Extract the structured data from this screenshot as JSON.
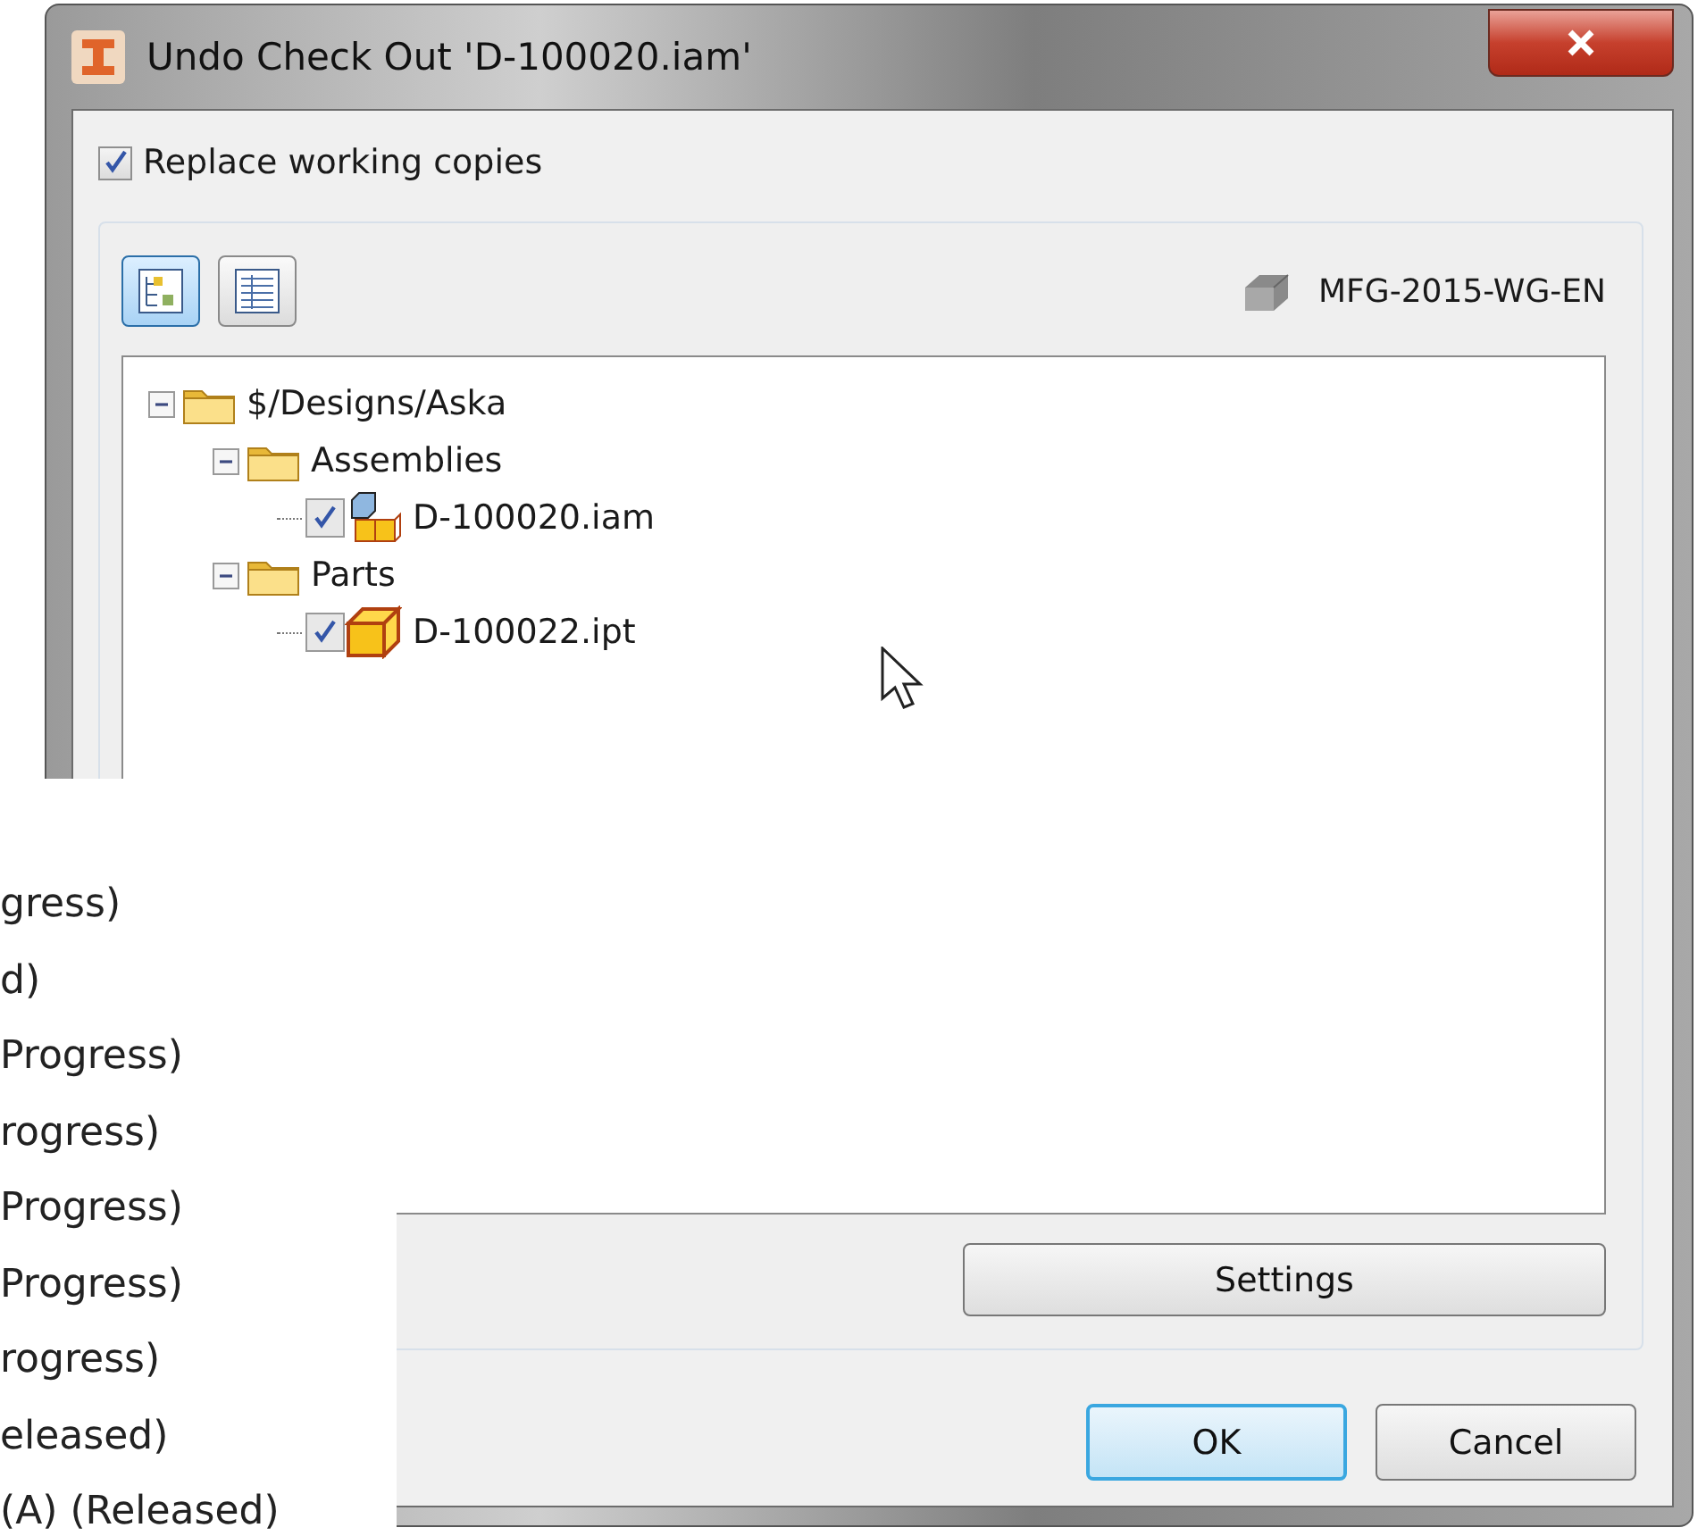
{
  "window": {
    "title": "Undo Check Out 'D-100020.iam'"
  },
  "replace_working_copies": {
    "label": "Replace working copies",
    "checked": true
  },
  "view_buttons": [
    {
      "kind": "tree",
      "selected": true
    },
    {
      "kind": "list",
      "selected": false
    }
  ],
  "vault": {
    "name": "MFG-2015-WG-EN"
  },
  "tree": [
    {
      "kind": "folder",
      "label": "$/Designs/Aska",
      "expanded": true,
      "children": [
        {
          "kind": "folder",
          "label": "Assemblies",
          "expanded": true,
          "children": [
            {
              "kind": "assembly",
              "label": "D-100020.iam",
              "checked": true
            }
          ]
        },
        {
          "kind": "folder",
          "label": "Parts",
          "expanded": true,
          "children": [
            {
              "kind": "part",
              "label": "D-100022.ipt",
              "checked": true
            }
          ]
        }
      ]
    }
  ],
  "settings_button": "Settings",
  "buttons": [
    {
      "label": "OK",
      "selected": true
    },
    {
      "label": "Cancel",
      "selected": false
    }
  ],
  "background_list": [
    "gress)",
    "d)",
    "Progress)",
    "rogress)",
    "Progress)",
    "Progress)",
    "rogress)",
    "eleased)",
    "(A) (Released)"
  ]
}
